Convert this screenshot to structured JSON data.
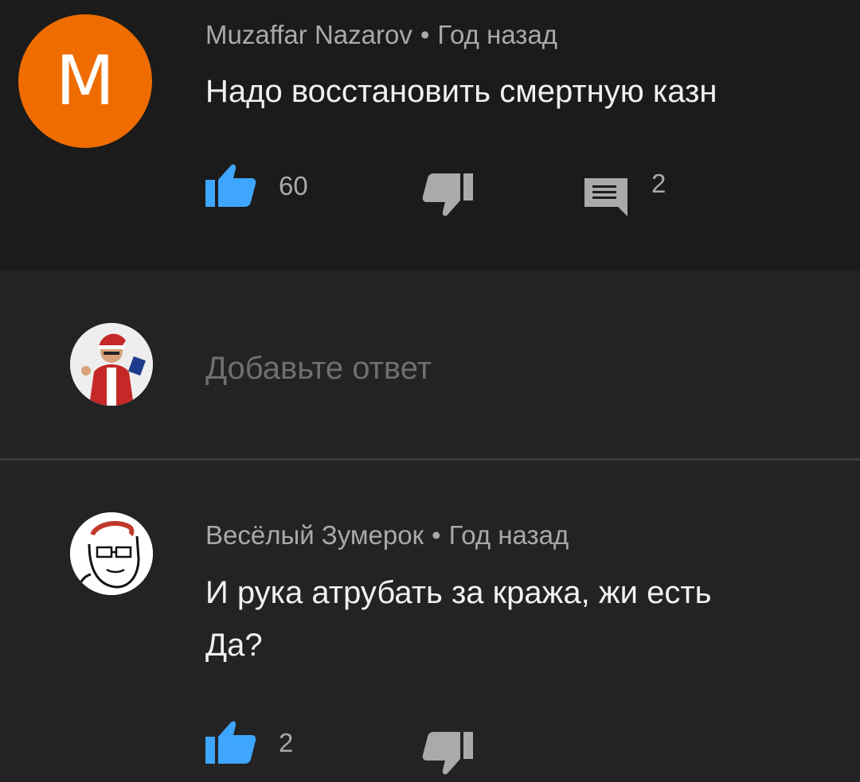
{
  "comment1": {
    "avatar_letter": "M",
    "author": "Muzaffar Nazarov",
    "separator": "•",
    "time": "Год назад",
    "text": "Надо восстановить смертную казн",
    "likes": "60",
    "replies": "2",
    "avatar_color": "#ef6c00"
  },
  "reply_box": {
    "placeholder": "Добавьте ответ"
  },
  "comment2": {
    "author": "Весёлый Зумерок",
    "separator": "•",
    "time": "Год назад",
    "text_line1": "И рука атрубать за кража, жи есть",
    "text_line2": "Да?",
    "likes": "2"
  },
  "icons": {
    "like": "thumbs-up-icon",
    "dislike": "thumbs-down-icon",
    "reply": "comment-icon"
  },
  "colors": {
    "like_active": "#3ea6ff",
    "icon_gray": "#aaaaaa",
    "background": "#232323",
    "comment_background": "#1b1b1b"
  }
}
